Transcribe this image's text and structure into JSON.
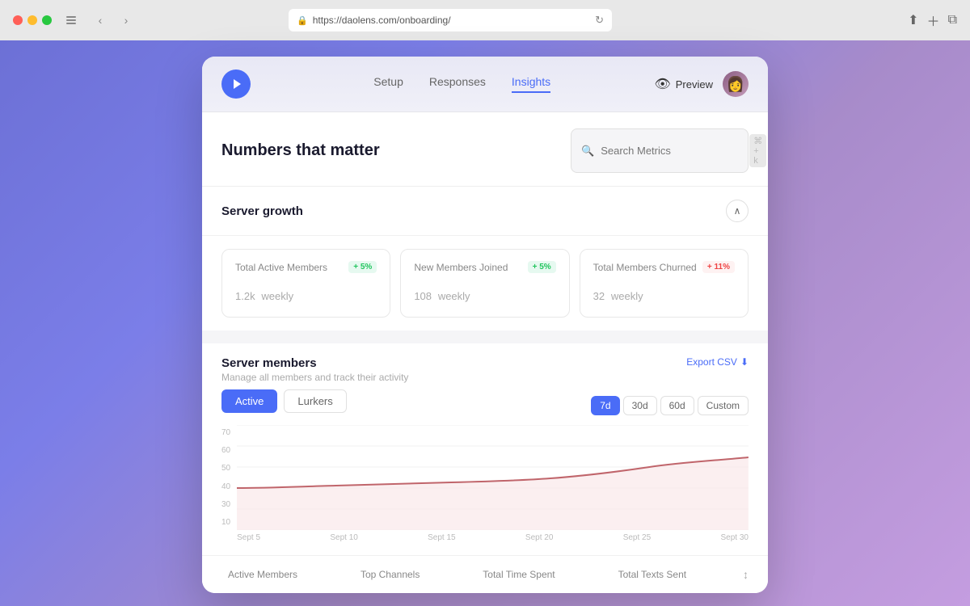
{
  "browser": {
    "url": "https://daolens.com/onboarding/",
    "traffic_lights": [
      "red",
      "yellow",
      "green"
    ]
  },
  "nav": {
    "logo_icon": "▶",
    "links": [
      {
        "label": "Setup",
        "active": false
      },
      {
        "label": "Responses",
        "active": false
      },
      {
        "label": "Insights",
        "active": true
      }
    ],
    "preview_label": "Preview",
    "avatar_emoji": "👩"
  },
  "header": {
    "title": "Numbers that matter",
    "search_placeholder": "Search Metrics",
    "search_shortcut": "⌘ + k"
  },
  "server_growth": {
    "section_title": "Server growth",
    "metrics": [
      {
        "label": "Total Active Members",
        "badge": "+ 5%",
        "badge_type": "green",
        "value": "1.2k",
        "unit": "weekly"
      },
      {
        "label": "New Members Joined",
        "badge": "+ 5%",
        "badge_type": "green",
        "value": "108",
        "unit": "weekly"
      },
      {
        "label": "Total Members Churned",
        "badge": "+ 11%",
        "badge_type": "red",
        "value": "32",
        "unit": "weekly"
      }
    ]
  },
  "server_members": {
    "title": "Server members",
    "subtitle": "Manage all members and track their activity",
    "export_label": "Export CSV",
    "time_filters": [
      "7d",
      "30d",
      "60d",
      "Custom"
    ],
    "active_filter": "7d",
    "view_toggles": [
      "Active",
      "Lurkers"
    ],
    "active_view": "Active",
    "chart": {
      "y_labels": [
        "70",
        "60",
        "50",
        "40",
        "30",
        "10"
      ],
      "x_labels": [
        "Sept 5",
        "Sept 10",
        "Sept 15",
        "Sept 20",
        "Sept 25",
        "Sept 30"
      ]
    }
  },
  "bottom_tabs": [
    "Active Members",
    "Top Channels",
    "Total Time Spent",
    "Total Texts Sent"
  ],
  "colors": {
    "accent": "#4a6cf7",
    "green_badge": "#22c55e",
    "red_badge": "#ef4444"
  }
}
